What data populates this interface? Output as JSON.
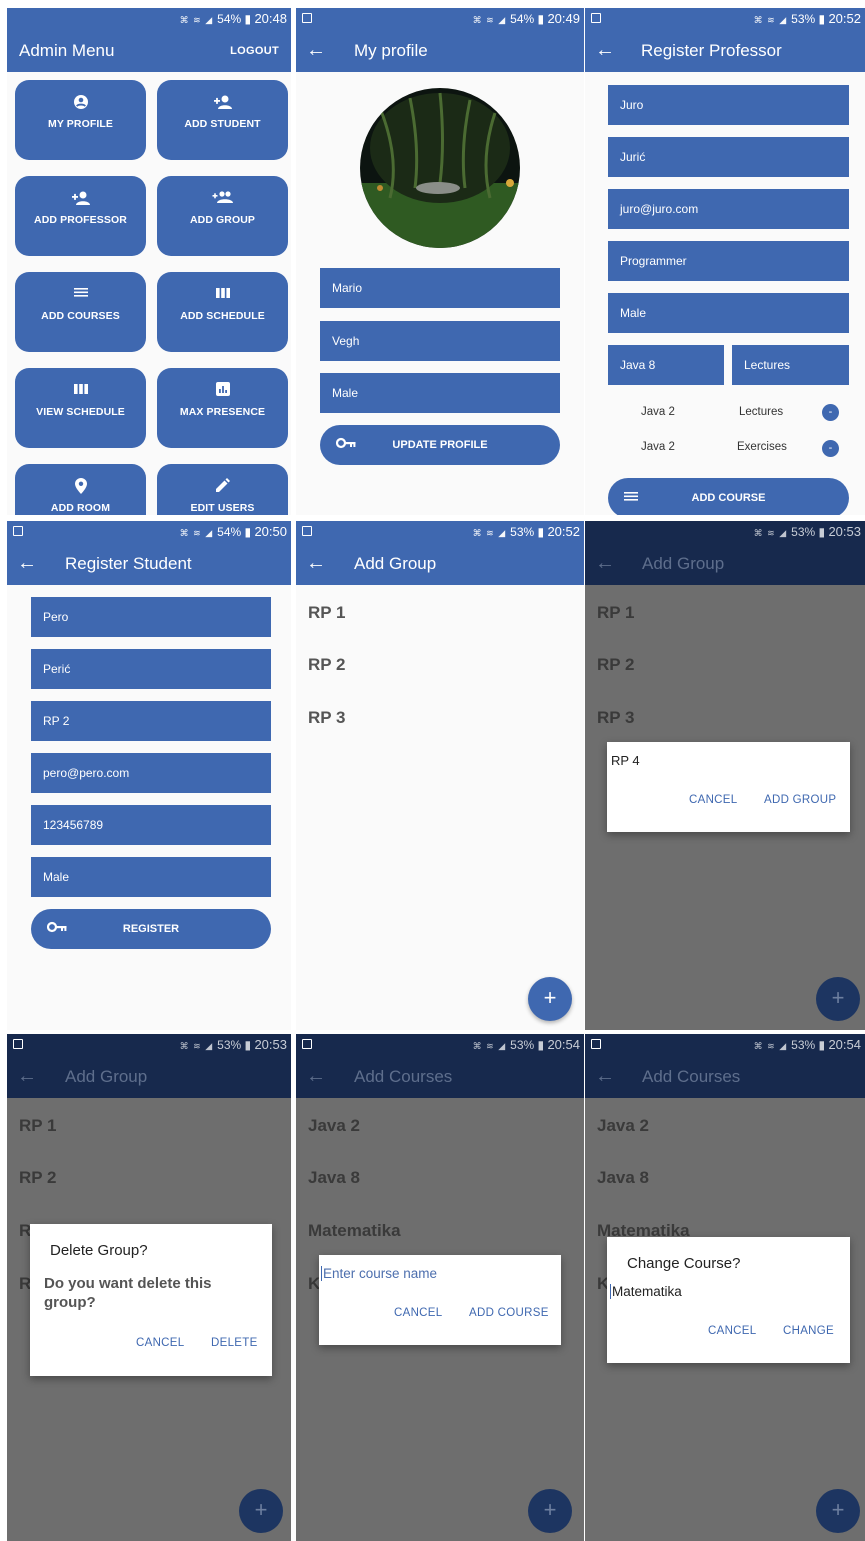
{
  "status": {
    "p1": {
      "battery": "54%",
      "time": "20:48"
    },
    "p2": {
      "battery": "54%",
      "time": "20:49"
    },
    "p3": {
      "battery": "53%",
      "time": "20:52"
    },
    "p4": {
      "battery": "54%",
      "time": "20:50"
    },
    "p5": {
      "battery": "53%",
      "time": "20:52"
    },
    "p6": {
      "battery": "53%",
      "time": "20:53"
    },
    "p7": {
      "battery": "53%",
      "time": "20:53"
    },
    "p8": {
      "battery": "53%",
      "time": "20:54"
    },
    "p9": {
      "battery": "53%",
      "time": "20:54"
    }
  },
  "admin": {
    "title": "Admin Menu",
    "logout": "LOGOUT",
    "tiles": [
      {
        "label": "MY PROFILE",
        "icon": "account-circle-icon"
      },
      {
        "label": "ADD STUDENT",
        "icon": "person-add-icon"
      },
      {
        "label": "ADD PROFESSOR",
        "icon": "person-add-icon"
      },
      {
        "label": "ADD GROUP",
        "icon": "group-add-icon"
      },
      {
        "label": "ADD COURSES",
        "icon": "list-icon"
      },
      {
        "label": "ADD SCHEDULE",
        "icon": "columns-icon"
      },
      {
        "label": "VIEW SCHEDULE",
        "icon": "columns-icon"
      },
      {
        "label": "MAX PRESENCE",
        "icon": "bar-chart-icon"
      },
      {
        "label": "ADD ROOM",
        "icon": "location-pin-icon"
      },
      {
        "label": "EDIT USERS",
        "icon": "pencil-icon"
      }
    ]
  },
  "profile": {
    "title": "My profile",
    "first_name": "Mario",
    "last_name": "Vegh",
    "gender": "Male",
    "update_button": "UPDATE PROFILE"
  },
  "professor": {
    "title": "Register Professor",
    "first_name": "Juro",
    "last_name": "Jurić",
    "email": "juro@juro.com",
    "title_field": "Programmer",
    "gender": "Male",
    "course_select": "Java 8",
    "type_select": "Lectures",
    "courses": [
      {
        "course": "Java 2",
        "type": "Lectures"
      },
      {
        "course": "Java 2",
        "type": "Exercises"
      }
    ],
    "remove_symbol": "-",
    "add_course_button": "ADD COURSE"
  },
  "student": {
    "title": "Register Student",
    "first_name": "Pero",
    "last_name": "Perić",
    "group": "RP 2",
    "email": "pero@pero.com",
    "id_number": "123456789",
    "gender": "Male",
    "register_button": "REGISTER"
  },
  "groups": {
    "title": "Add Group",
    "items": [
      "RP 1",
      "RP 2",
      "RP 3"
    ],
    "fab": "+"
  },
  "add_group_dialog": {
    "input_value": "RP 4",
    "cancel": "CANCEL",
    "confirm": "ADD GROUP"
  },
  "delete_group_dialog": {
    "title": "Delete Group?",
    "message": "Do you want delete this group?",
    "cancel": "CANCEL",
    "confirm": "DELETE",
    "visible_fragments": [
      "R",
      "R"
    ]
  },
  "courses": {
    "title": "Add Courses",
    "items": [
      "Java 2",
      "Java 8",
      "Matematika"
    ],
    "partial_item": "K"
  },
  "add_course_dialog": {
    "placeholder": "Enter course name",
    "cancel": "CANCEL",
    "confirm": "ADD COURSE"
  },
  "change_course_dialog": {
    "title": "Change Course?",
    "input_value": "Matematika",
    "cancel": "CANCEL",
    "confirm": "CHANGE"
  },
  "colors": {
    "primary": "#3f68b0",
    "scrim_bar": "#17294d",
    "scrim_body": "#6e6e6e"
  }
}
